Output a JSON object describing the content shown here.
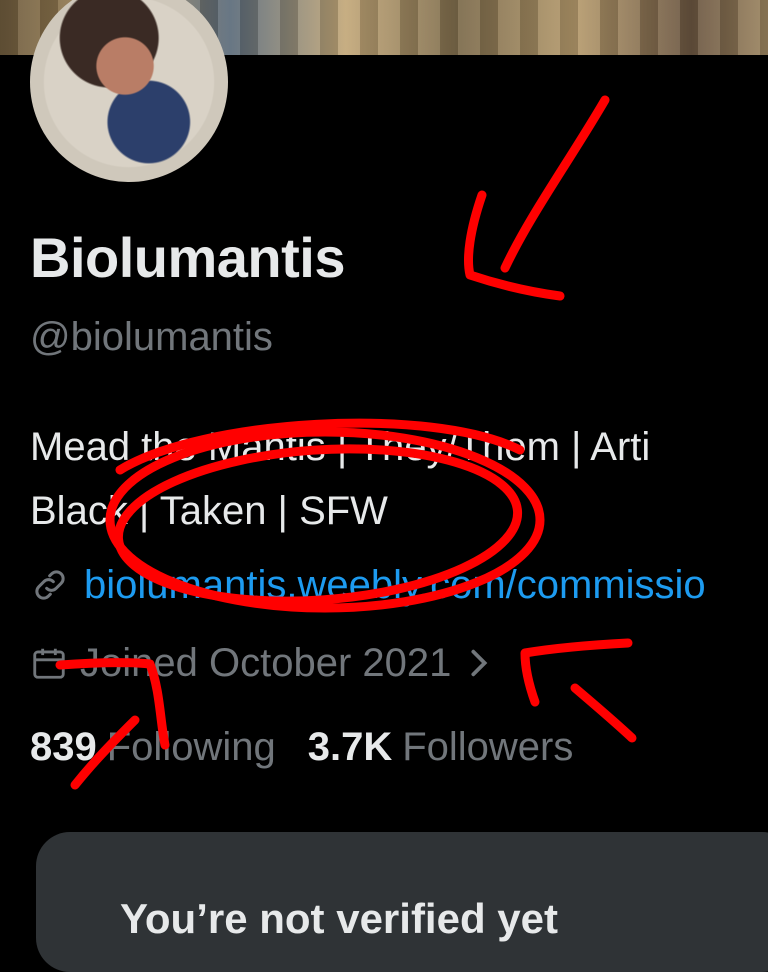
{
  "profile": {
    "display_name": "Biolumantis",
    "handle": "@biolumantis",
    "bio_line1": "Mead the Mantis | They/Them | Arti",
    "bio_line2": "Black | Taken | SFW",
    "link": "biolumantis.weebly.com/commissio",
    "joined": "Joined October 2021",
    "following_count": "839",
    "following_label": "Following",
    "followers_count": "3.7K",
    "followers_label": "Followers"
  },
  "verify_card": {
    "title": "You’re not verified yet"
  },
  "icons": {
    "link": "link-icon",
    "calendar": "calendar-icon",
    "chevron": "chevron-right-icon"
  },
  "colors": {
    "background": "#000000",
    "primary_text": "#e7e9ea",
    "secondary_text": "#71767b",
    "link": "#1d9bf0",
    "card": "#2f3336",
    "annotation": "#ff0000"
  }
}
